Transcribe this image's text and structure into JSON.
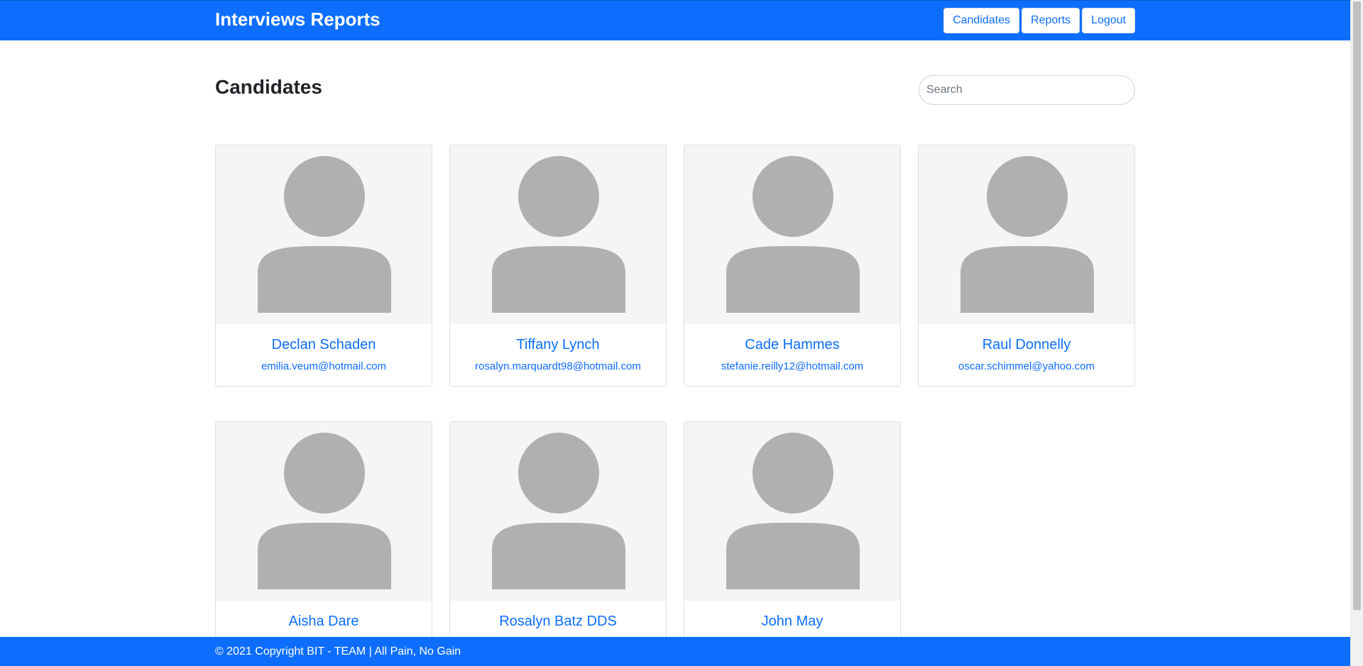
{
  "navbar": {
    "brand": "Interviews Reports",
    "buttons": [
      "Candidates",
      "Reports",
      "Logout"
    ]
  },
  "page": {
    "title": "Candidates",
    "search_placeholder": "Search"
  },
  "candidates": [
    {
      "name": "Declan Schaden",
      "email": "emilia.veum@hotmail.com"
    },
    {
      "name": "Tiffany Lynch",
      "email": "rosalyn.marquardt98@hotmail.com"
    },
    {
      "name": "Cade Hammes",
      "email": "stefanie.reilly12@hotmail.com"
    },
    {
      "name": "Raul Donnelly",
      "email": "oscar.schimmel@yahoo.com"
    },
    {
      "name": "Aisha Dare",
      "email": ""
    },
    {
      "name": "Rosalyn Batz DDS",
      "email": ""
    },
    {
      "name": "John May",
      "email": ""
    }
  ],
  "footer": {
    "text": "© 2021 Copyright BIT - TEAM | All Pain, No Gain"
  },
  "colors": {
    "primary": "#0d6efd",
    "avatar_bg": "#f5f5f5",
    "avatar_fg": "#b0b0b0"
  },
  "icons": {
    "avatar": "person-placeholder-icon"
  }
}
